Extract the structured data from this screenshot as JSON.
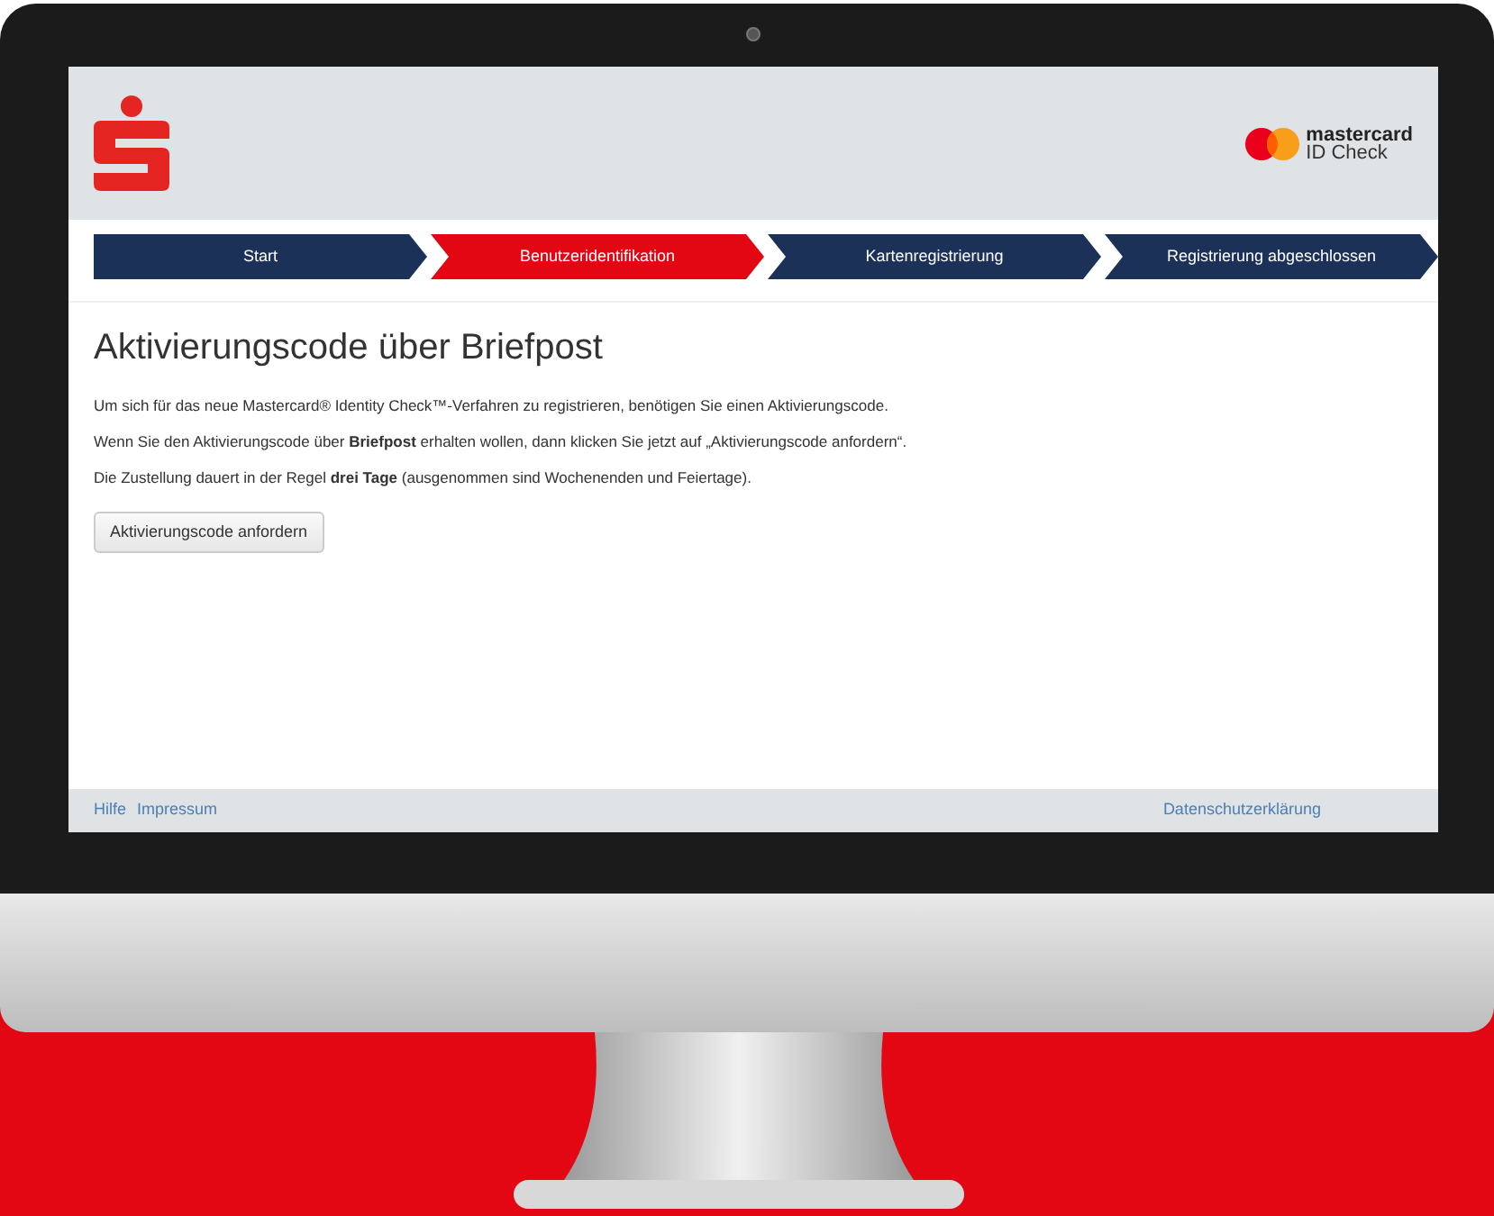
{
  "header": {
    "partner_logo": {
      "name": "mastercard",
      "subtitle": "ID Check"
    }
  },
  "steps": [
    {
      "label": "Start",
      "selected": false
    },
    {
      "label": "Benutzeridentifikation",
      "selected": true
    },
    {
      "label": "Kartenregistrierung",
      "selected": false
    },
    {
      "label": "Registrierung abgeschlossen",
      "selected": false
    }
  ],
  "title": "Aktivierungscode über Briefpost",
  "paragraphs": [
    "Um sich für das neue Mastercard® Identity Check™-Verfahren zu registrieren, benötigen Sie einen Aktivierungscode.",
    "Wenn Sie den Aktivierungscode über **Briefpost** erhalten wollen, dann klicken Sie jetzt auf „Aktivierungscode anfordern“.",
    "Die Zustellung dauert in der Regel **drei Tage** (ausgenommen sind Wochenenden und Feiertage)."
  ],
  "button": "Aktivierungscode anfordern",
  "footer": {
    "left_links": [
      "Hilfe",
      "Impressum"
    ],
    "right_links": [
      "Datenschutzerklärung"
    ]
  }
}
